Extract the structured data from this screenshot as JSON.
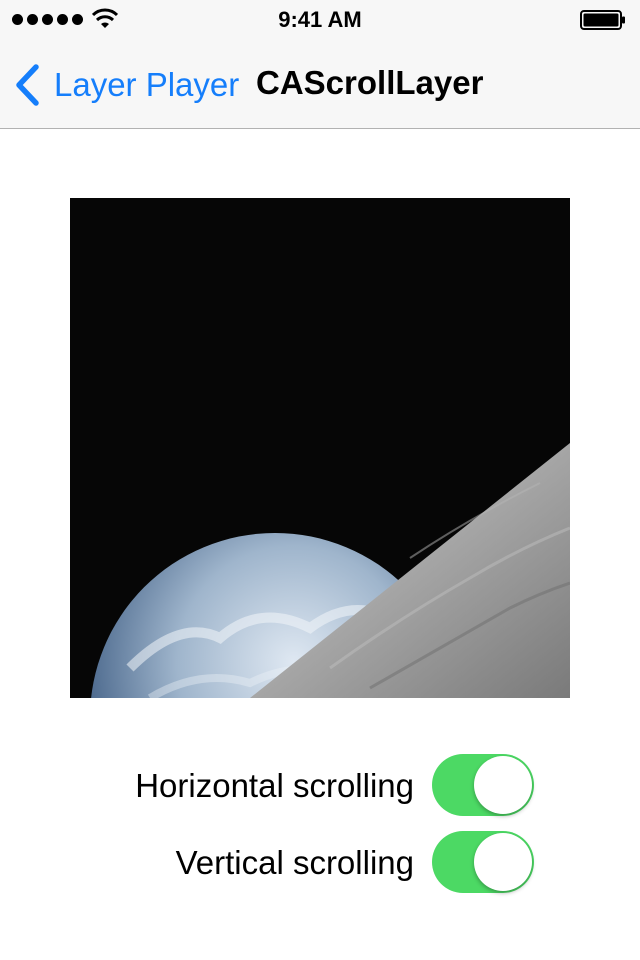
{
  "status_bar": {
    "time": "9:41 AM",
    "signal_icon": "signal-dots-icon",
    "wifi_icon": "wifi-icon",
    "battery_icon": "battery-icon"
  },
  "nav_bar": {
    "back_label": "Layer Player",
    "back_icon": "chevron-left-icon",
    "title": "CAScrollLayer"
  },
  "photo": {
    "subject": "earthrise-image"
  },
  "switches": [
    {
      "label": "Horizontal scrolling",
      "on": true
    },
    {
      "label": "Vertical scrolling",
      "on": true
    }
  ],
  "colors": {
    "accent": "#157efb",
    "switch_on": "#4cd964",
    "bar_background": "#f7f7f7"
  }
}
